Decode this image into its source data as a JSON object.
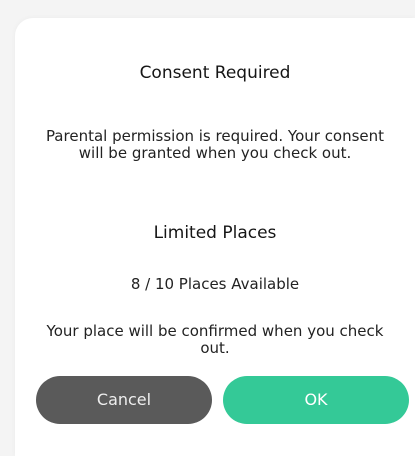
{
  "dialog": {
    "consent_title": "Consent Required",
    "consent_text": "Parental permission is required. Your consent will be granted when you check out.",
    "limited_title": "Limited Places",
    "places_text": "8 / 10 Places Available",
    "confirm_text": "Your place will be confirmed when you check out."
  },
  "buttons": {
    "cancel_label": "Cancel",
    "ok_label": "OK"
  },
  "colors": {
    "cancel": "#5a5a5a",
    "ok": "#34c997"
  }
}
